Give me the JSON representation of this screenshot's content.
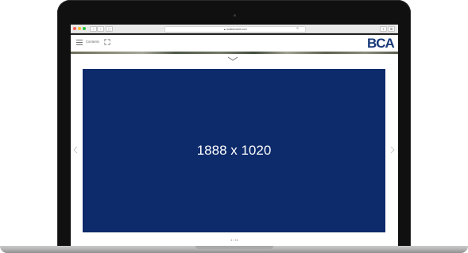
{
  "browser": {
    "url": "▲ aviationweek.com",
    "reload_glyph": "↻",
    "nav": {
      "back": "‹",
      "forward": "›",
      "sidebar": "▯"
    },
    "share": "⇧",
    "tabs": "⧉"
  },
  "app": {
    "contents_label": "Contents",
    "logo_text": "BCA"
  },
  "content": {
    "placeholder_text": "1888 x 1020",
    "page_indicator": "4 / 15"
  },
  "colors": {
    "placeholder_bg": "#0d2b6b",
    "logo": "#183a7a"
  },
  "icons": {
    "menu": "menu-icon",
    "expand": "expand-icon",
    "chevron_down": "chevron-down-icon",
    "prev": "chevron-left-icon",
    "next": "chevron-right-icon"
  }
}
